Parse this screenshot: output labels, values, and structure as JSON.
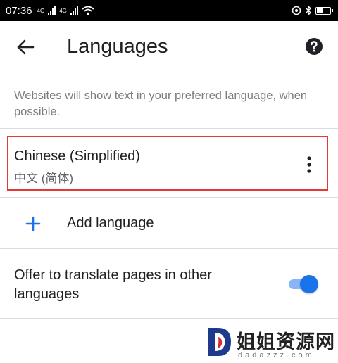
{
  "status_bar": {
    "time": "07:36",
    "signal_labels": [
      "4G",
      "4G"
    ]
  },
  "toolbar": {
    "title": "Languages",
    "back_icon": "arrow-back-icon",
    "help_icon": "help-circle-icon"
  },
  "description": "Websites will show text in your preferred language, when possible.",
  "languages": [
    {
      "name": "Chinese (Simplified)",
      "native_name": "中文 (简体)",
      "menu_icon": "more-vert-icon",
      "highlight_color": "#e53935"
    }
  ],
  "add_language": {
    "label": "Add language",
    "icon": "plus-icon"
  },
  "translate": {
    "label": "Offer to translate pages in other languages",
    "enabled": true
  },
  "colors": {
    "accent": "#1a73e8",
    "toggle_track": "#8ab4f8",
    "highlight": "#e53935"
  },
  "watermark": {
    "title": "姐姐资源网",
    "url": "dadazzz.com"
  }
}
